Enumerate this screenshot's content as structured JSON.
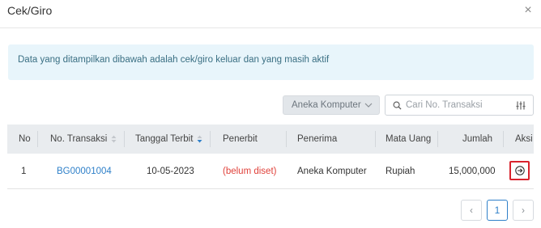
{
  "modal": {
    "title": "Cek/Giro",
    "close_symbol": "×"
  },
  "alert": {
    "text": "Data yang ditampilkan dibawah adalah cek/giro keluar dan yang masih aktif"
  },
  "toolbar": {
    "account_select": {
      "selected": "Aneka Komputer"
    },
    "search": {
      "placeholder": "Cari No. Transaksi",
      "value": ""
    }
  },
  "table": {
    "columns": [
      "No",
      "No. Transaksi",
      "Tanggal Terbit",
      "Penerbit",
      "Penerima",
      "Mata Uang",
      "Jumlah",
      "Aksi"
    ],
    "sorted_column": "Tanggal Terbit",
    "rows": [
      {
        "no": "1",
        "no_transaksi": "BG00001004",
        "tanggal_terbit": "10-05-2023",
        "penerbit": "(belum diset)",
        "penerima": "Aneka Komputer",
        "mata_uang": "Rupiah",
        "jumlah": "15,000,000"
      }
    ]
  },
  "pagination": {
    "prev": "‹",
    "current": "1",
    "next": "›"
  },
  "colors": {
    "accent": "#2f80c9",
    "danger": "#e0413a",
    "alert_bg": "#e8f5fb",
    "header_bg": "#e9ecef",
    "action_border": "#d9232d"
  }
}
